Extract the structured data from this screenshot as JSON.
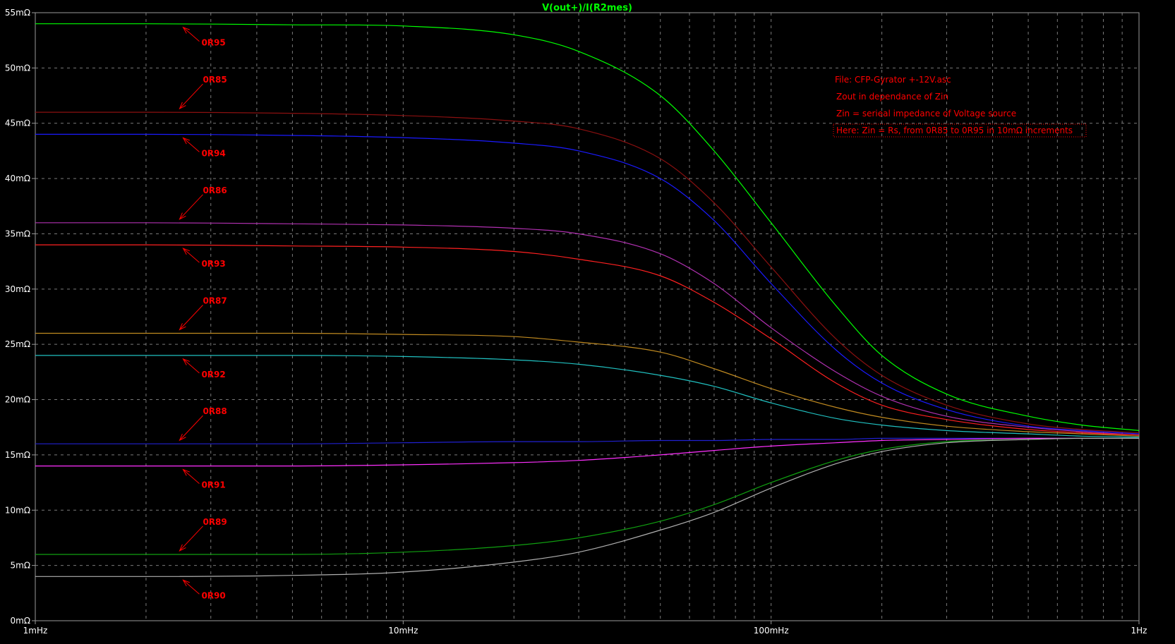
{
  "colors": {
    "background": "#000000",
    "frame": "#9a9a9a",
    "grid": "#7a7a7a",
    "tick_text": "#ffffff",
    "title": "#00ff00",
    "annotation": "#ff0000"
  },
  "chart_data": {
    "type": "line",
    "title": "V(out+)/I(R2mes)",
    "x_scale": "log",
    "xlim": [
      0.001,
      1
    ],
    "ylim": [
      0,
      0.055
    ],
    "grid": true,
    "x_ticks": [
      {
        "value": 0.001,
        "label": "1mHz"
      },
      {
        "value": 0.01,
        "label": "10mHz"
      },
      {
        "value": 0.1,
        "label": "100mHz"
      },
      {
        "value": 1,
        "label": "1Hz"
      }
    ],
    "y_ticks": [
      {
        "value": 0,
        "label": "0mΩ"
      },
      {
        "value": 0.005,
        "label": "5mΩ"
      },
      {
        "value": 0.01,
        "label": "10mΩ"
      },
      {
        "value": 0.015,
        "label": "15mΩ"
      },
      {
        "value": 0.02,
        "label": "20mΩ"
      },
      {
        "value": 0.025,
        "label": "25mΩ"
      },
      {
        "value": 0.03,
        "label": "30mΩ"
      },
      {
        "value": 0.035,
        "label": "35mΩ"
      },
      {
        "value": 0.04,
        "label": "40mΩ"
      },
      {
        "value": 0.045,
        "label": "45mΩ"
      },
      {
        "value": 0.05,
        "label": "50mΩ"
      },
      {
        "value": 0.055,
        "label": "55mΩ"
      }
    ],
    "x": [
      0.001,
      0.002,
      0.005,
      0.01,
      0.02,
      0.03,
      0.05,
      0.07,
      0.1,
      0.15,
      0.2,
      0.3,
      0.5,
      0.7,
      1
    ],
    "series": [
      {
        "name": "0R95",
        "color": "#00ff00",
        "values": [
          0.054,
          0.054,
          0.0539,
          0.0538,
          0.053,
          0.0515,
          0.0475,
          0.0425,
          0.036,
          0.0285,
          0.024,
          0.0205,
          0.0185,
          0.0177,
          0.0172
        ]
      },
      {
        "name": "0R85",
        "color": "#8b1010",
        "values": [
          0.046,
          0.046,
          0.0459,
          0.0457,
          0.0452,
          0.0445,
          0.0418,
          0.0378,
          0.032,
          0.0255,
          0.0222,
          0.0195,
          0.0178,
          0.0173,
          0.017
        ]
      },
      {
        "name": "0R94",
        "color": "#1a1aff",
        "values": [
          0.044,
          0.044,
          0.0439,
          0.0437,
          0.0432,
          0.0425,
          0.04,
          0.0362,
          0.0305,
          0.0245,
          0.0215,
          0.0191,
          0.0176,
          0.0172,
          0.0169
        ]
      },
      {
        "name": "0R86",
        "color": "#b030b0",
        "values": [
          0.036,
          0.036,
          0.0359,
          0.0358,
          0.0355,
          0.035,
          0.0332,
          0.0305,
          0.0265,
          0.0225,
          0.0203,
          0.0185,
          0.0175,
          0.0171,
          0.0168
        ]
      },
      {
        "name": "0R93",
        "color": "#ff2020",
        "values": [
          0.034,
          0.034,
          0.0339,
          0.0338,
          0.0334,
          0.0327,
          0.0312,
          0.0288,
          0.0255,
          0.0215,
          0.0195,
          0.0182,
          0.0173,
          0.017,
          0.0168
        ]
      },
      {
        "name": "0R87",
        "color": "#c08a20",
        "values": [
          0.026,
          0.026,
          0.026,
          0.0259,
          0.0257,
          0.0252,
          0.0243,
          0.0228,
          0.021,
          0.0193,
          0.0184,
          0.0176,
          0.0171,
          0.0169,
          0.0167
        ]
      },
      {
        "name": "0R92",
        "color": "#20c0c0",
        "values": [
          0.024,
          0.024,
          0.024,
          0.0239,
          0.0236,
          0.0232,
          0.0222,
          0.0212,
          0.0197,
          0.0183,
          0.0177,
          0.0172,
          0.0169,
          0.0167,
          0.0166
        ]
      },
      {
        "name": "0R88",
        "color": "#2020d0",
        "values": [
          0.016,
          0.016,
          0.016,
          0.0161,
          0.0162,
          0.0162,
          0.0163,
          0.0163,
          0.0164,
          0.0164,
          0.0165,
          0.0165,
          0.0165,
          0.0165,
          0.0165
        ]
      },
      {
        "name": "0R91",
        "color": "#ff30ff",
        "values": [
          0.014,
          0.014,
          0.014,
          0.0141,
          0.0143,
          0.0145,
          0.015,
          0.0154,
          0.0158,
          0.0161,
          0.0163,
          0.0164,
          0.0165,
          0.0165,
          0.0165
        ]
      },
      {
        "name": "0R89",
        "color": "#10a010",
        "values": [
          0.006,
          0.006,
          0.006,
          0.0062,
          0.0068,
          0.0075,
          0.009,
          0.0105,
          0.0125,
          0.0145,
          0.0155,
          0.0162,
          0.0164,
          0.0165,
          0.0165
        ]
      },
      {
        "name": "0R90",
        "color": "#b0b0b0",
        "values": [
          0.004,
          0.004,
          0.0041,
          0.0044,
          0.0053,
          0.0062,
          0.0082,
          0.0098,
          0.012,
          0.0142,
          0.0153,
          0.0161,
          0.0164,
          0.0165,
          0.0165
        ]
      }
    ],
    "annotations": [
      {
        "text": "File: CFP-Gyrator +-12V.asc"
      },
      {
        "text": "Zout in dependance of Zin"
      },
      {
        "text": "Zin = serieal impedance of Voltage source"
      },
      {
        "text": "Here: Zin = Rs, from 0R85 to 0R95 in 10mΩ increments"
      }
    ]
  }
}
